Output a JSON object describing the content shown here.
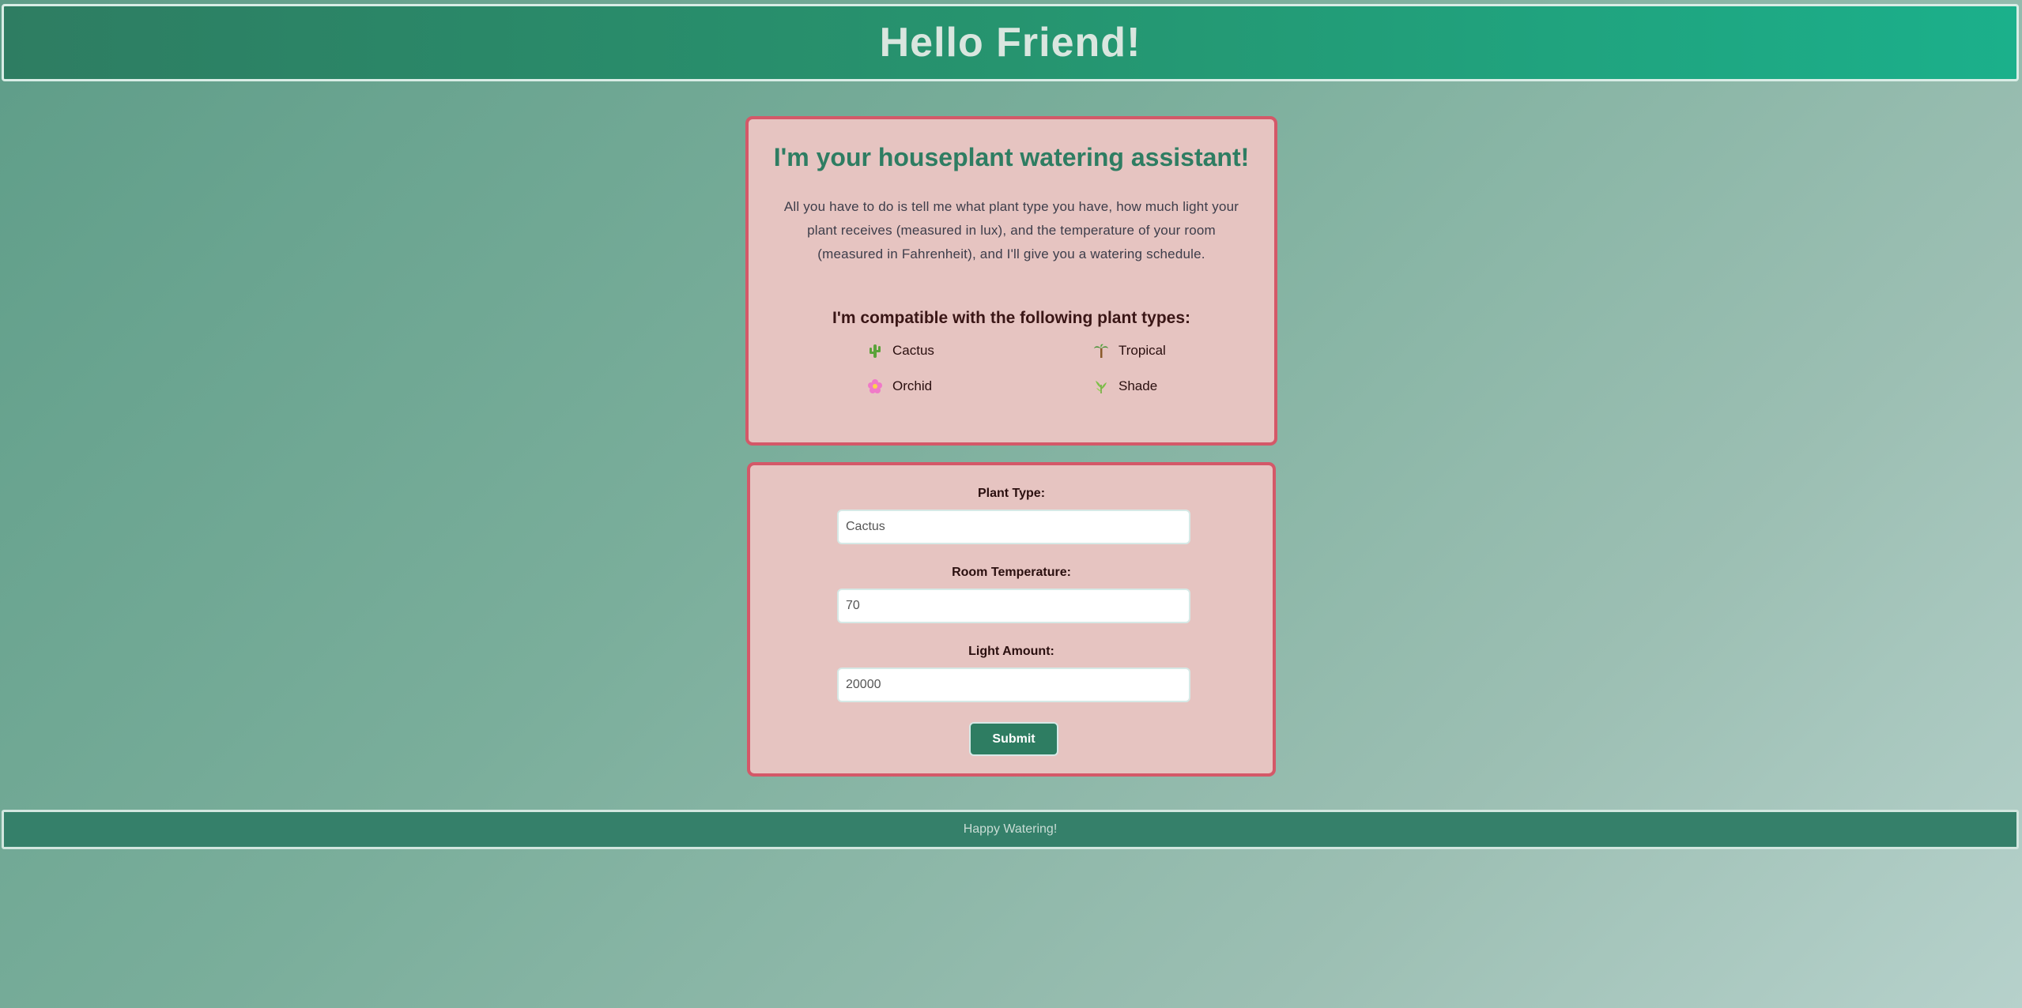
{
  "header": {
    "title": "Hello Friend!"
  },
  "intro": {
    "title": "I'm your houseplant watering assistant!",
    "description_lines": [
      "All you have to do is tell me what plant type you have, how much light your",
      "plant receives (measured in lux), and the temperature of your room",
      "(measured in Fahrenheit), and I'll give you a watering schedule."
    ],
    "compat_title": "I'm compatible with the following plant types:",
    "plants": [
      {
        "label": "Cactus",
        "icon": "cactus-icon"
      },
      {
        "label": "Tropical",
        "icon": "palm-tree-icon"
      },
      {
        "label": "Orchid",
        "icon": "flower-icon"
      },
      {
        "label": "Shade",
        "icon": "herb-icon"
      }
    ]
  },
  "form": {
    "plant_type": {
      "label": "Plant Type:",
      "value": "Cactus"
    },
    "room_temperature": {
      "label": "Room Temperature:",
      "value": "70"
    },
    "light_amount": {
      "label": "Light Amount:",
      "value": "20000"
    },
    "submit_label": "Submit"
  },
  "footer": {
    "text": "Happy Watering!"
  },
  "colors": {
    "accent": "#2e7d62",
    "card_bg": "#e6c4c1",
    "card_border": "#d45868"
  }
}
